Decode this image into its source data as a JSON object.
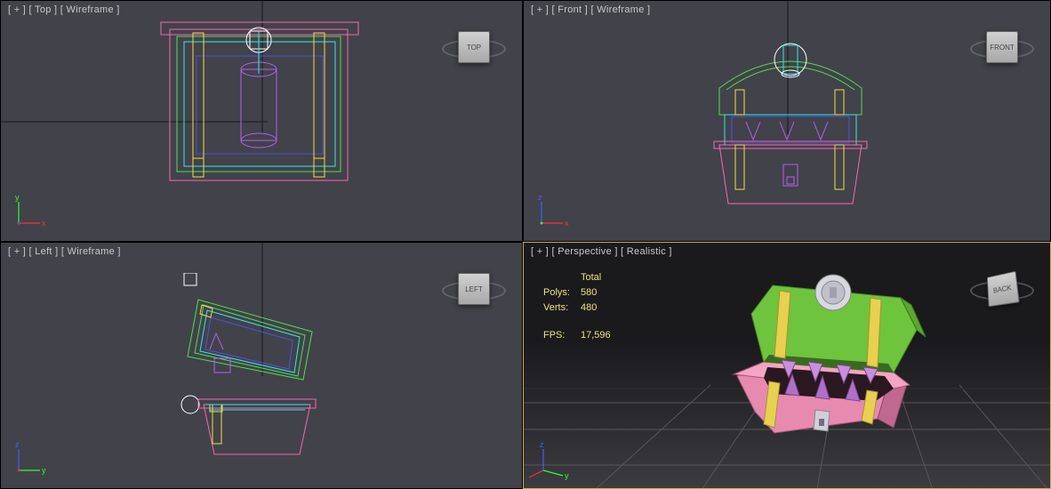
{
  "viewports": {
    "top": {
      "menu": "[ + ]",
      "name": "[ Top ]",
      "mode": "[ Wireframe ]",
      "cube": "TOP",
      "axis_v": "y",
      "axis_h": "x"
    },
    "front": {
      "menu": "[ + ]",
      "name": "[ Front ]",
      "mode": "[ Wireframe ]",
      "cube": "FRONT",
      "axis_v": "z",
      "axis_h": "x"
    },
    "left": {
      "menu": "[ + ]",
      "name": "[ Left ]",
      "mode": "[ Wireframe ]",
      "cube": "LEFT",
      "axis_v": "z",
      "axis_h": "y"
    },
    "persp": {
      "menu": "[ + ]",
      "name": "[ Perspective ]",
      "mode": "[ Realistic ]",
      "cube": "BACK",
      "axis_v": "z",
      "axis_h": "y"
    }
  },
  "stats": {
    "header": "Total",
    "polys_label": "Polys:",
    "polys": "580",
    "verts_label": "Verts:",
    "verts": "480",
    "fps_label": "FPS:",
    "fps": "17,596"
  },
  "colors": {
    "pink": "#f668b2",
    "green": "#4de04d",
    "cyan": "#30e8e8",
    "yellow": "#f0e040",
    "purple": "#b060f0",
    "blue": "#5050e0",
    "white": "#ffffff",
    "stats": "#ece27a",
    "axis_x": "#ff3030",
    "axis_y": "#30ff30",
    "axis_z": "#4060ff"
  },
  "model": {
    "lid_green": "#6ec43c",
    "body_pink": "#e88ab0",
    "teeth_purple": "#b070c8",
    "strap_yellow": "#e8d050",
    "lock_grey": "#c8c8d0",
    "mouth_dark": "#2a1820"
  }
}
